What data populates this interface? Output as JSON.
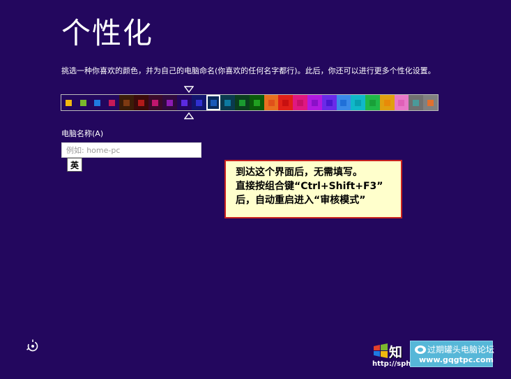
{
  "page": {
    "title": "个性化",
    "description": "挑选一种你喜欢的颜色，并为自己的电脑命名(你喜欢的任何名字都行)。此后，你还可以进行更多个性化设置。"
  },
  "palette": {
    "selected_index": 10,
    "swatches": [
      {
        "bg": "#23075e",
        "chip": "#f0b80f"
      },
      {
        "bg": "#23075e",
        "chip": "#7ab82c"
      },
      {
        "bg": "#23075e",
        "chip": "#1f7ae0"
      },
      {
        "bg": "#23075e",
        "chip": "#c51a57"
      },
      {
        "bg": "#3a1c08",
        "chip": "#7d3a12"
      },
      {
        "bg": "#3a0a0a",
        "chip": "#b01a1a"
      },
      {
        "bg": "#3a0a2a",
        "chip": "#c0166e"
      },
      {
        "bg": "#300a3e",
        "chip": "#8c1bb3"
      },
      {
        "bg": "#23075e",
        "chip": "#5b2ae0"
      },
      {
        "bg": "#12156e",
        "chip": "#3030d0"
      },
      {
        "bg": "#0a2a5a",
        "chip": "#1a5ab8"
      },
      {
        "bg": "#0a3a4e",
        "chip": "#0d7aa0"
      },
      {
        "bg": "#0a3e1e",
        "chip": "#1a9a30"
      },
      {
        "bg": "#0a5a0a",
        "chip": "#20a020"
      },
      {
        "bg": "#e87020",
        "chip": "#e0501a"
      },
      {
        "bg": "#e02018",
        "chip": "#c81010"
      },
      {
        "bg": "#e01880",
        "chip": "#c8106a"
      },
      {
        "bg": "#b01ae0",
        "chip": "#8a10c8"
      },
      {
        "bg": "#6a2ae8",
        "chip": "#4a18d0"
      },
      {
        "bg": "#3a8ae8",
        "chip": "#2070d8"
      },
      {
        "bg": "#10b8c8",
        "chip": "#08a0b0"
      },
      {
        "bg": "#20b848",
        "chip": "#18a038"
      },
      {
        "bg": "#e0a010",
        "chip": "#e88a08"
      },
      {
        "bg": "#e878c8",
        "chip": "#e060b8"
      },
      {
        "bg": "#707070",
        "chip": "#4a9a9a"
      },
      {
        "bg": "#808080",
        "chip": "#e07030"
      }
    ]
  },
  "form": {
    "pc_name_label": "电脑名称(A)",
    "pc_name_placeholder": "例如: home-pc",
    "ime_indicator": "英"
  },
  "annotation": {
    "line1": "到达这个界面后，无需填写。",
    "line2": "直接按组合键“Ctrl+Shift+F3”",
    "line3": "后，自动重启进入“审核模式”"
  },
  "watermark": {
    "brand": "知",
    "url": "http://sph",
    "forum_name": "过期罐头电脑论坛",
    "forum_url": "www.gqgtpc.com"
  },
  "icons": {
    "ease_of_access": "ease-of-access-icon",
    "color_down": "triangle-down-icon",
    "color_up": "triangle-up-icon"
  }
}
